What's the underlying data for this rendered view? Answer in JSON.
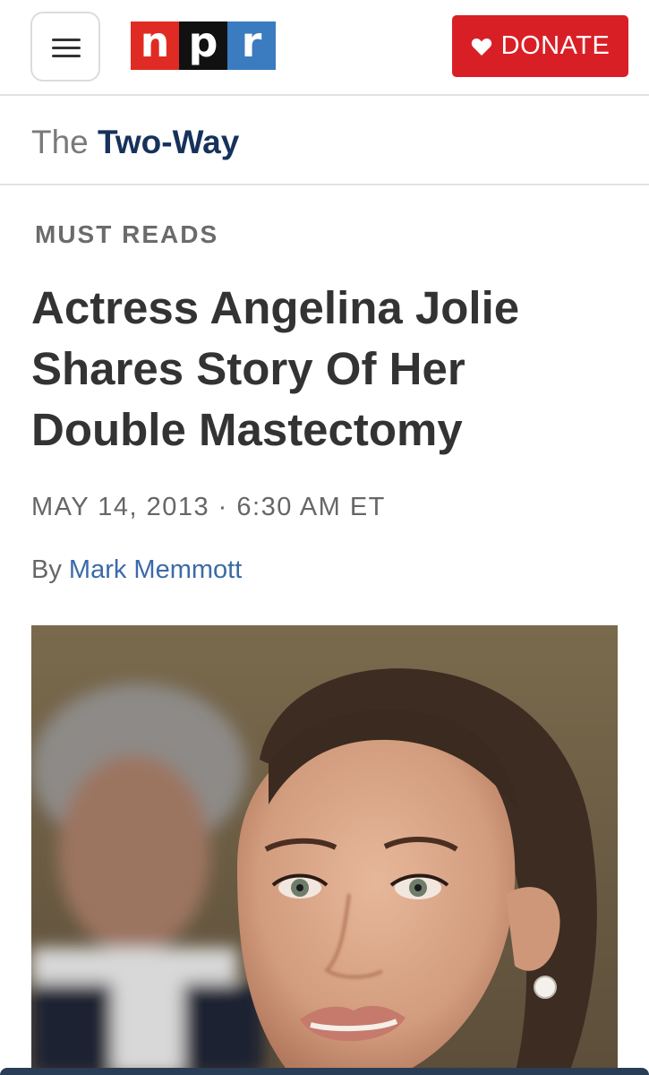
{
  "header": {
    "menu_icon": "hamburger-menu-icon",
    "logo": {
      "letters": [
        "n",
        "p",
        "r"
      ],
      "colors": [
        "#e02b24",
        "#111111",
        "#3b7bc0"
      ]
    },
    "donate": {
      "label": "DONATE",
      "icon": "heart-icon",
      "color": "#d91f26"
    }
  },
  "section": {
    "prefix": "The",
    "name": "Two-Way"
  },
  "article": {
    "kicker": "MUST READS",
    "headline": "Actress Angelina Jolie Shares Story Of Her Double Mastectomy",
    "dateline": "MAY 14, 2013 · 6:30 AM ET",
    "byline_prefix": "By",
    "author": "Mark Memmott"
  },
  "photo": {
    "subject": "woman-portrait-photo"
  }
}
